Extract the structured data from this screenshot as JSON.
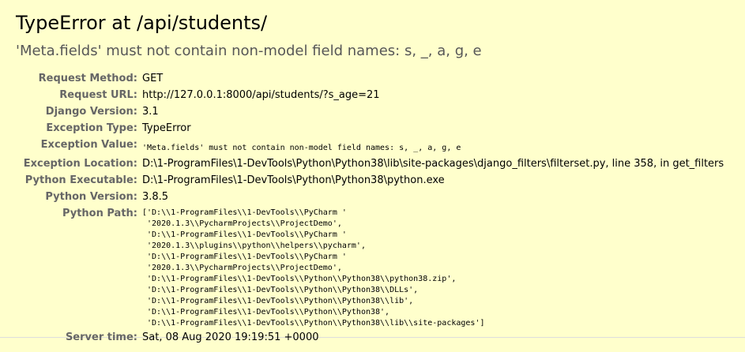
{
  "error": {
    "title": "TypeError at /api/students/",
    "message": "'Meta.fields' must not contain non-model field names: s, _, a, g, e"
  },
  "meta": {
    "request_method_label": "Request Method:",
    "request_method": "GET",
    "request_url_label": "Request URL:",
    "request_url": "http://127.0.0.1:8000/api/students/?s_age=21",
    "django_version_label": "Django Version:",
    "django_version": "3.1",
    "exception_type_label": "Exception Type:",
    "exception_type": "TypeError",
    "exception_value_label": "Exception Value:",
    "exception_value": "'Meta.fields' must not contain non-model field names: s, _, a, g, e",
    "exception_location_label": "Exception Location:",
    "exception_location": "D:\\1-ProgramFiles\\1-DevTools\\Python\\Python38\\lib\\site-packages\\django_filters\\filterset.py, line 358, in get_filters",
    "python_executable_label": "Python Executable:",
    "python_executable": "D:\\1-ProgramFiles\\1-DevTools\\Python\\Python38\\python.exe",
    "python_version_label": "Python Version:",
    "python_version": "3.8.5",
    "python_path_label": "Python Path:",
    "python_path": "['D:\\\\1-ProgramFiles\\\\1-DevTools\\\\PyCharm '\n '2020.1.3\\\\PycharmProjects\\\\ProjectDemo',\n 'D:\\\\1-ProgramFiles\\\\1-DevTools\\\\PyCharm '\n '2020.1.3\\\\plugins\\\\python\\\\helpers\\\\pycharm',\n 'D:\\\\1-ProgramFiles\\\\1-DevTools\\\\PyCharm '\n '2020.1.3\\\\PycharmProjects\\\\ProjectDemo',\n 'D:\\\\1-ProgramFiles\\\\1-DevTools\\\\Python\\\\Python38\\\\python38.zip',\n 'D:\\\\1-ProgramFiles\\\\1-DevTools\\\\Python\\\\Python38\\\\DLLs',\n 'D:\\\\1-ProgramFiles\\\\1-DevTools\\\\Python\\\\Python38\\\\lib',\n 'D:\\\\1-ProgramFiles\\\\1-DevTools\\\\Python\\\\Python38',\n 'D:\\\\1-ProgramFiles\\\\1-DevTools\\\\Python\\\\Python38\\\\lib\\\\site-packages']",
    "server_time_label": "Server time:",
    "server_time": "Sat, 08 Aug 2020 19:19:51 +0000"
  },
  "colors": {
    "background": "#ffffcc",
    "label": "#666666",
    "subtitle": "#575757"
  }
}
